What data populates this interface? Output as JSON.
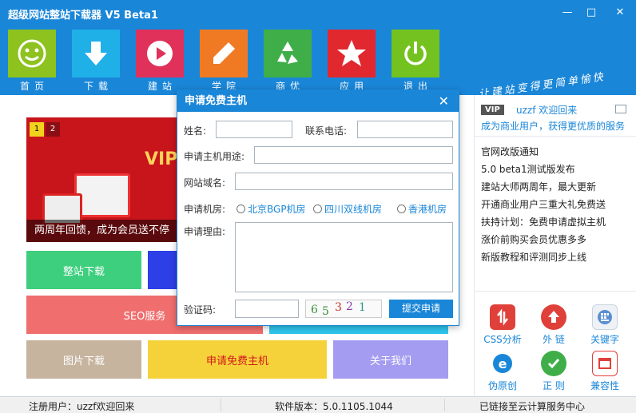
{
  "app": {
    "title": "超级网站整站下载器 V5 Beta1"
  },
  "window": {
    "minimize": "—",
    "maximize": "□",
    "close": "✕"
  },
  "toolbar": [
    {
      "label": "首页",
      "icon": "smile-icon",
      "color": "#8dc21f"
    },
    {
      "label": "下载",
      "icon": "download-icon",
      "color": "#1fb0e8"
    },
    {
      "label": "建站",
      "icon": "play-icon",
      "color": "#e0315b"
    },
    {
      "label": "学院",
      "icon": "pencil-icon",
      "color": "#f07a23"
    },
    {
      "label": "商优",
      "icon": "recycle-icon",
      "color": "#3fae49"
    },
    {
      "label": "应用",
      "icon": "star-icon",
      "color": "#e2282f"
    },
    {
      "label": "退出",
      "icon": "power-icon",
      "color": "#73c21f"
    }
  ],
  "slogan": "让建站变得更简单愉快",
  "banner": {
    "pages": [
      "1",
      "2"
    ],
    "vip": "VIP",
    "caption": "两周年回馈，成为会员送不停"
  },
  "tiles": {
    "site_download": "整站下载",
    "seo": "SEO服务",
    "image_download": "图片下载",
    "free_host": "申请免费主机",
    "about": "关于我们"
  },
  "right": {
    "vip_badge": "VIP",
    "welcome": "uzzf   欢迎回来",
    "promo": "成为商业用户，获得更优质的服务",
    "news": [
      "官网改版通知",
      "5.0 beta1测试版发布",
      "建站大师两周年，最大更新",
      "开通商业用户三重大礼免费送",
      "扶持计划：免费申请虚拟主机",
      "涨价前购买会员优惠多多",
      "新版教程和评测同步上线"
    ],
    "quick": [
      {
        "label": "CSS分析",
        "icon": "css-analysis-icon",
        "color": "#e0403a"
      },
      {
        "label": "外 链",
        "icon": "upload-link-icon",
        "color": "#e0403a"
      },
      {
        "label": "关键字",
        "icon": "keyword-icon",
        "color": "#5a8fd0"
      },
      {
        "label": "伪原创",
        "icon": "ie-icon",
        "color": "#1a86d8"
      },
      {
        "label": "正 则",
        "icon": "regex-icon",
        "color": "#3fae49"
      },
      {
        "label": "兼容性",
        "icon": "compat-icon",
        "color": "#e0403a"
      }
    ]
  },
  "dialog": {
    "title": "申请免费主机",
    "name_label": "姓名:",
    "phone_label": "联系电话:",
    "purpose_label": "申请主机用途:",
    "domain_label": "网站域名:",
    "room_label": "申请机房:",
    "rooms": [
      "北京BGP机房",
      "四川双线机房",
      "香港机房"
    ],
    "reason_label": "申请理由:",
    "captcha_label": "验证码:",
    "captcha_chars": [
      "6",
      "5",
      "3",
      "2",
      "1"
    ],
    "submit": "提交申请"
  },
  "status": {
    "user": "注册用户：uzzf欢迎回来",
    "version": "软件版本：5.0.1105.1044",
    "connection": "已链接至云计算服务中心"
  }
}
